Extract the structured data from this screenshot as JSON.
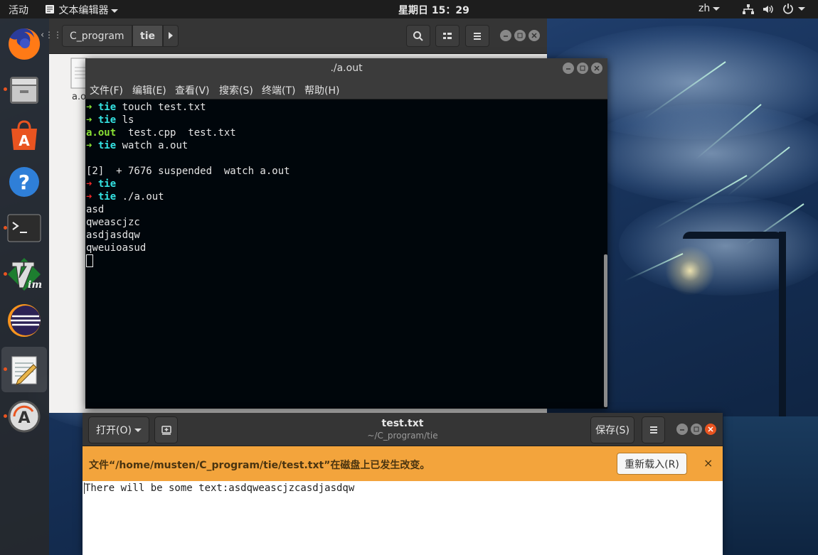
{
  "topbar": {
    "activities": "活动",
    "app_menu": "文本编辑器",
    "clock": "星期日 15：29",
    "input_method": "zh"
  },
  "dock": {
    "items": [
      "firefox-icon",
      "files-icon",
      "software-center-icon",
      "help-icon",
      "terminal-icon",
      "vim-icon",
      "eclipse-icon",
      "text-editor-icon",
      "software-updater-icon"
    ]
  },
  "file_manager": {
    "crumbs": [
      "C_program",
      "tie"
    ],
    "file_label": "a.o"
  },
  "terminal": {
    "title": "./a.out",
    "menu": [
      "文件(F)",
      "编辑(E)",
      "查看(V)",
      "搜索(S)",
      "终端(T)",
      "帮助(H)"
    ],
    "lines": [
      {
        "arrow": "➜",
        "arrow_color": "g",
        "dir": "tie",
        "cmd": " touch test.txt"
      },
      {
        "arrow": "➜",
        "arrow_color": "g",
        "dir": "tie",
        "cmd": " ls"
      },
      {
        "ls_exec": "a.out",
        "ls_rest": "  test.cpp  test.txt"
      },
      {
        "arrow": "➜",
        "arrow_color": "g",
        "dir": "tie",
        "cmd": " watch a.out"
      },
      {
        "plain": ""
      },
      {
        "plain": "[2]  + 7676 suspended  watch a.out"
      },
      {
        "arrow": "➜",
        "arrow_color": "r",
        "dir": "tie",
        "cmd": ""
      },
      {
        "arrow": "➜",
        "arrow_color": "r",
        "dir": "tie",
        "cmd": " ./a.out"
      },
      {
        "plain": "asd"
      },
      {
        "plain": "qweascjzc"
      },
      {
        "plain": "asdjasdqw"
      },
      {
        "plain": "qweuioasud"
      }
    ]
  },
  "gedit": {
    "open_label": "打开(O)",
    "title": "test.txt",
    "subtitle": "~/C_program/tie",
    "save_label": "保存(S)",
    "infobar_message": "文件“/home/musten/C_program/tie/test.txt”在磁盘上已发生改变。",
    "reload_label": "重新载入(R)",
    "close_symbol": "×",
    "content": "There will be some text:asdqweascjzcasdjasdqw"
  }
}
